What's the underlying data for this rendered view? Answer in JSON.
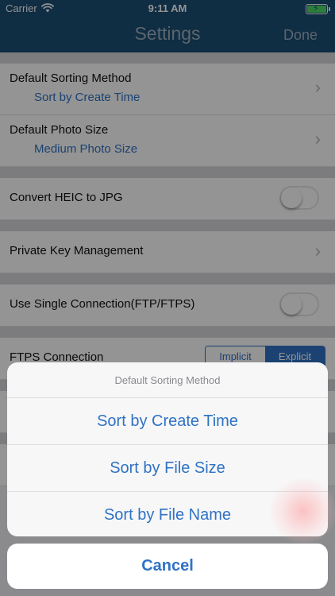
{
  "status_bar": {
    "carrier": "Carrier",
    "time": "9:11 AM",
    "wifi_icon": "wifi-icon",
    "battery_icon": "battery-charging-icon"
  },
  "nav": {
    "title": "Settings",
    "done_label": "Done"
  },
  "settings": {
    "sorting": {
      "label": "Default Sorting Method",
      "value": "Sort by Create Time"
    },
    "photo_size": {
      "label": "Default Photo Size",
      "value": "Medium Photo Size"
    },
    "heic": {
      "label": "Convert HEIC to JPG",
      "enabled": false
    },
    "private_key": {
      "label": "Private Key Management"
    },
    "single_connection": {
      "label": "Use Single Connection(FTP/FTPS)",
      "enabled": false
    },
    "ftps": {
      "label": "FTPS Connection",
      "options": [
        "Implicit",
        "Explicit"
      ],
      "selected": "Explicit"
    }
  },
  "action_sheet": {
    "title": "Default Sorting Method",
    "options": [
      "Sort by Create Time",
      "Sort by File Size",
      "Sort by File Name"
    ],
    "cancel_label": "Cancel"
  },
  "colors": {
    "nav_bar": "#1b4e74",
    "accent": "#2f72c4",
    "battery": "#4cd964"
  }
}
